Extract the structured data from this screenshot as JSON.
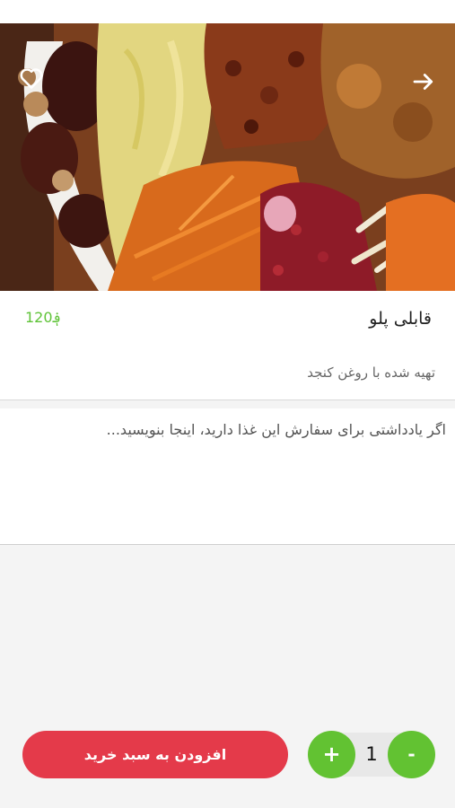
{
  "dish": {
    "name": "قابلی پلو",
    "price": "120؋",
    "description": "تهیه شده با روغن کنجد"
  },
  "note": {
    "placeholder": "اگر یادداشتی برای سفارش این غذا دارید، اینجا بنویسید..."
  },
  "cart": {
    "add_label": "افزودن به سبد خرید",
    "quantity": "1",
    "plus_label": "+",
    "minus_label": "-"
  },
  "icons": {
    "favorite": "heart-icon",
    "forward": "arrow-right-icon"
  },
  "colors": {
    "accent_green": "#5fc338",
    "add_button_red": "#e43a4a"
  }
}
